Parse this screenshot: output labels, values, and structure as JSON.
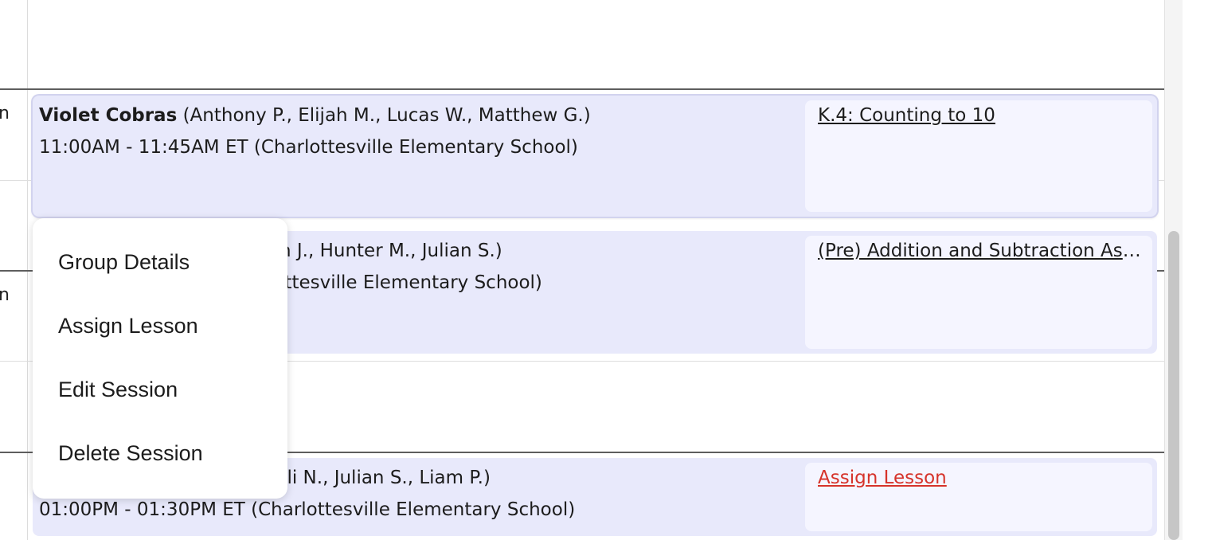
{
  "sessions": [
    {
      "group_name": "Violet Cobras",
      "students": "(Anthony P., Elijah M., Lucas W., Matthew G.)",
      "time_location": "11:00AM - 11:45AM ET (Charlottesville Elementary School)",
      "lesson": "K.4: Counting to 10"
    },
    {
      "students_visible": "nin J., Hunter M., Julian S.)",
      "time_location_visible": "lottesville Elementary School)",
      "lesson": "(Pre) Addition and Subtraction Assessment"
    },
    {
      "students_visible": "., Eli N., Julian S., Liam P.)",
      "time_location": "01:00PM - 01:30PM ET (Charlottesville Elementary School)",
      "lesson": "Assign Lesson"
    }
  ],
  "context_menu": {
    "items": [
      "Group Details",
      "Assign Lesson",
      "Edit Session",
      "Delete Session"
    ]
  },
  "gutter_fragments": [
    "n",
    "n"
  ],
  "colors": {
    "card_bg": "#e8e9fb",
    "lesson_bg": "#f5f5ff",
    "assign_link": "#d6332a"
  }
}
